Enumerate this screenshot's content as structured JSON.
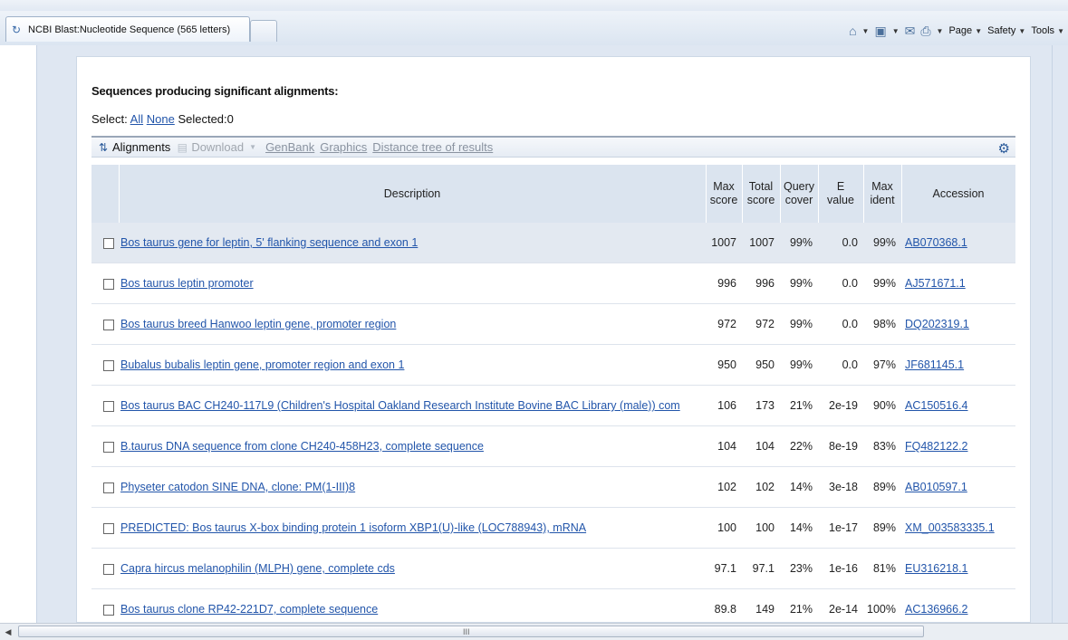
{
  "browser": {
    "tab_title": "NCBI Blast:Nucleotide Sequence (565 letters)",
    "commands": [
      "Page",
      "Safety",
      "Tools"
    ]
  },
  "results": {
    "section_title": "Sequences producing significant alignments:",
    "select_label": "Select:",
    "select_all": "All",
    "select_none": "None",
    "selected_label": "Selected:0"
  },
  "toolbar": {
    "alignments": "Alignments",
    "download": "Download",
    "genbank": "GenBank",
    "graphics": "Graphics",
    "distance_tree": "Distance tree of results"
  },
  "table": {
    "headers": {
      "description": "Description",
      "max_score_1": "Max",
      "max_score_2": "score",
      "total_score_1": "Total",
      "total_score_2": "score",
      "query_cover_1": "Query",
      "query_cover_2": "cover",
      "e_value_1": "E",
      "e_value_2": "value",
      "max_ident_1": "Max",
      "max_ident_2": "ident",
      "accession": "Accession"
    },
    "rows": [
      {
        "desc": "Bos taurus gene for leptin, 5' flanking sequence and exon 1",
        "max": "1007",
        "total": "1007",
        "cover": "99%",
        "e": "0.0",
        "ident": "99%",
        "acc": "AB070368.1"
      },
      {
        "desc": "Bos taurus leptin promoter",
        "max": "996",
        "total": "996",
        "cover": "99%",
        "e": "0.0",
        "ident": "99%",
        "acc": "AJ571671.1"
      },
      {
        "desc": "Bos taurus breed Hanwoo leptin gene, promoter region",
        "max": "972",
        "total": "972",
        "cover": "99%",
        "e": "0.0",
        "ident": "98%",
        "acc": "DQ202319.1"
      },
      {
        "desc": "Bubalus bubalis leptin gene, promoter region and exon 1",
        "max": "950",
        "total": "950",
        "cover": "99%",
        "e": "0.0",
        "ident": "97%",
        "acc": "JF681145.1"
      },
      {
        "desc": "Bos taurus BAC CH240-117L9 (Children's Hospital Oakland Research Institute Bovine BAC Library (male)) com",
        "max": "106",
        "total": "173",
        "cover": "21%",
        "e": "2e-19",
        "ident": "90%",
        "acc": "AC150516.4"
      },
      {
        "desc": "B.taurus DNA sequence from clone CH240-458H23, complete sequence",
        "max": "104",
        "total": "104",
        "cover": "22%",
        "e": "8e-19",
        "ident": "83%",
        "acc": "FQ482122.2"
      },
      {
        "desc": "Physeter catodon SINE DNA, clone: PM(1-III)8",
        "max": "102",
        "total": "102",
        "cover": "14%",
        "e": "3e-18",
        "ident": "89%",
        "acc": "AB010597.1"
      },
      {
        "desc": "PREDICTED: Bos taurus X-box binding protein 1 isoform XBP1(U)-like (LOC788943), mRNA",
        "max": "100",
        "total": "100",
        "cover": "14%",
        "e": "1e-17",
        "ident": "89%",
        "acc": "XM_003583335.1"
      },
      {
        "desc": "Capra hircus melanophilin (MLPH) gene, complete cds",
        "max": "97.1",
        "total": "97.1",
        "cover": "23%",
        "e": "1e-16",
        "ident": "81%",
        "acc": "EU316218.1"
      },
      {
        "desc": "Bos taurus clone RP42-221D7, complete sequence",
        "max": "89.8",
        "total": "149",
        "cover": "21%",
        "e": "2e-14",
        "ident": "100%",
        "acc": "AC136966.2"
      }
    ]
  },
  "scrollbar": {
    "grip": "III"
  }
}
